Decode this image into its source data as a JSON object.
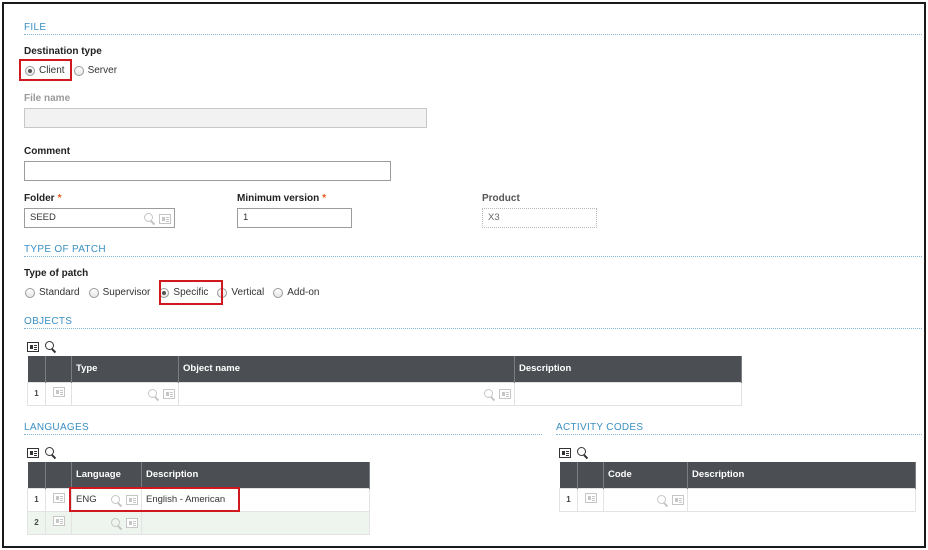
{
  "file_section": {
    "title": "FILE",
    "destination_type": {
      "label": "Destination type",
      "options": [
        "Client",
        "Server"
      ],
      "selected": "Client"
    },
    "file_name": {
      "label": "File name",
      "value": ""
    },
    "comment": {
      "label": "Comment",
      "value": ""
    },
    "folder": {
      "label": "Folder",
      "required_mark": "*",
      "value": "SEED"
    },
    "minimum_version": {
      "label": "Minimum version",
      "required_mark": "*",
      "value": "1"
    },
    "product": {
      "label": "Product",
      "value": "X3"
    }
  },
  "patch_section": {
    "title": "TYPE OF PATCH",
    "type_of_patch": {
      "label": "Type of patch",
      "options": [
        "Standard",
        "Supervisor",
        "Specific",
        "Vertical",
        "Add-on"
      ],
      "selected": "Specific"
    }
  },
  "objects_section": {
    "title": "OBJECTS",
    "columns": [
      "Type",
      "Object name",
      "Description"
    ],
    "rows": [
      {
        "num": "1",
        "type": "",
        "object_name": "",
        "description": ""
      }
    ]
  },
  "languages_section": {
    "title": "LANGUAGES",
    "columns": [
      "Language",
      "Description"
    ],
    "rows": [
      {
        "num": "1",
        "language": "ENG",
        "description": "English - American"
      },
      {
        "num": "2",
        "language": "",
        "description": ""
      }
    ]
  },
  "activity_section": {
    "title": "ACTIVITY CODES",
    "columns": [
      "Code",
      "Description"
    ],
    "rows": [
      {
        "num": "1",
        "code": "",
        "description": ""
      }
    ]
  },
  "colors": {
    "section_title": "#3a8fc4",
    "required": "#e85a1a",
    "highlight": "#d0191f",
    "grid_header": "#4b4f54"
  },
  "icons": {
    "search": "search-icon",
    "detail": "detail-card-icon",
    "grid_select": "select-icon"
  }
}
